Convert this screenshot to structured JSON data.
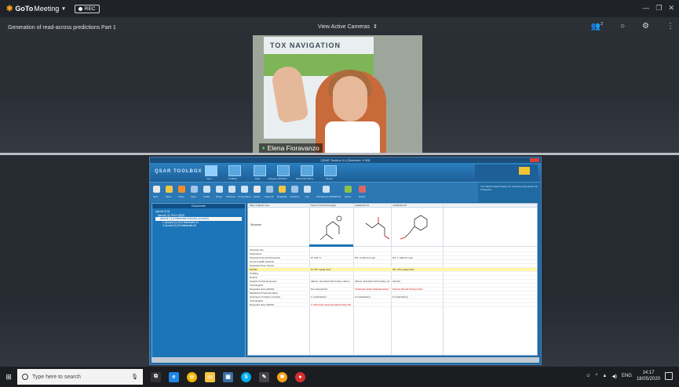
{
  "app": {
    "name_prefix": "GoTo",
    "name_suffix": "Meeting",
    "rec_label": "REC"
  },
  "meeting": {
    "title": "Generation of read-across predictions Part 1",
    "view_mode": "View Active Cameras",
    "participant_count": "2"
  },
  "camera": {
    "participant_name": "Elena Fioravanzo",
    "poster_title": "TOX NAVIGATION"
  },
  "shared_app": {
    "window_title": "QSAR Toolbox 4.4 (Selected: 4 KB)",
    "brand": "QSAR TOOLBOX",
    "ribbon_tabs": [
      "Input",
      "Profiling",
      "Data",
      "Category definition",
      "Data Gap Filling",
      "Report"
    ],
    "toolbar_buttons": [
      "New",
      "Open",
      "Close",
      "Save",
      "CAS#",
      "Name",
      "Structure",
      "Composition",
      "Select",
      "Clear All",
      "Database",
      "Inventory",
      "List",
      "Substances (SMARTS)",
      "Query",
      "Define"
    ],
    "side_text": "The OECD QSAR Toolbox for Grouping Chemicals into Categories",
    "documents_header": "Documents",
    "tree": [
      "Ipsum4 (2.8)",
      "Ipsum4 (1) 15-6-1 (5)(3)",
      "Ipsum4-1 (1) Metabolite simulator (nosubst)",
      "1: Ipsum4 (1) 15-6 Metabolite #1",
      "2: Ipsum4 (1) 15 Metabolite #2"
    ],
    "grid_headers": [
      "Filter endpoint tree...",
      "Parent chemical (target)",
      "metabolite #1",
      "metabolite #2"
    ],
    "structure_label": "Structure",
    "rows": [
      {
        "label": "Structure info",
        "v1": "",
        "v2": "",
        "v3": ""
      },
      {
        "label": "Parameters",
        "v1": "",
        "v2": "",
        "v3": ""
      },
      {
        "label": "Physical Chemical Properties",
        "v1": "M: 202 °C",
        "v2": "M1: 4.07E+04 mg/L",
        "v3": "M1: 1.73E+04 mg/L"
      },
      {
        "label": "Human Health Hazards",
        "v1": "",
        "v2": "",
        "v3": ""
      },
      {
        "label": "Repeated Dose Toxicity",
        "v1": "",
        "v2": "",
        "v3": ""
      },
      {
        "label": "NOAEL",
        "v1": "M: 997 mg/kg bw/d",
        "v2": "",
        "v3": "M3: 374 mg/kg bw/d"
      },
      {
        "label": "Profiling",
        "v1": "",
        "v2": "",
        "v3": ""
      },
      {
        "label": "Empiric",
        "v1": "",
        "v2": "",
        "v3": ""
      },
      {
        "label": "Organic functional groups",
        "v1": "Alkane, branched with tertiary carbon",
        "v2": "Alkane, branched with tertiary car",
        "v3": "Alcohol"
      },
      {
        "label": "Toxicological",
        "v1": "",
        "v2": "",
        "v3": ""
      },
      {
        "label": "Repeated dose (HESS)",
        "v1": "Not categorized",
        "v2": "Carboxylic acids (Hepatotoxicity)",
        "v3": "Styrene (Renal Toxicity) Alert"
      },
      {
        "label": "Metabolism/Transformation",
        "v1": "",
        "v2": "",
        "v3": ""
      },
      {
        "label": "Hydrolysis simulator (neutral)",
        "v1": "1 metabolite(s)",
        "v2": "0 metabolite(s)",
        "v3": "0 metabolite(s)"
      },
      {
        "label": "Toxicological",
        "v1": "",
        "v2": "",
        "v3": ""
      },
      {
        "label": "Repeated dose (HESS)",
        "v1": "1 Carboxylic acids (Hepatotoxicity) Ra...",
        "v2": "",
        "v3": ""
      }
    ]
  },
  "taskbar": {
    "search_placeholder": "Type here to search",
    "language": "ENG",
    "time": "14:17",
    "date": "18/05/2020"
  },
  "colors": {
    "goto_orange": "#f7a21b",
    "qsar_blue": "#1c75b8",
    "yellow_row": "#fff6a6"
  },
  "icons": [
    "gotomeeting-star-icon",
    "rec-dot-icon",
    "minimize-icon",
    "maximize-icon",
    "close-icon",
    "participants-icon",
    "chat-icon",
    "settings-icon",
    "more-icon",
    "windows-start-icon",
    "search-icon",
    "microphone-icon"
  ]
}
